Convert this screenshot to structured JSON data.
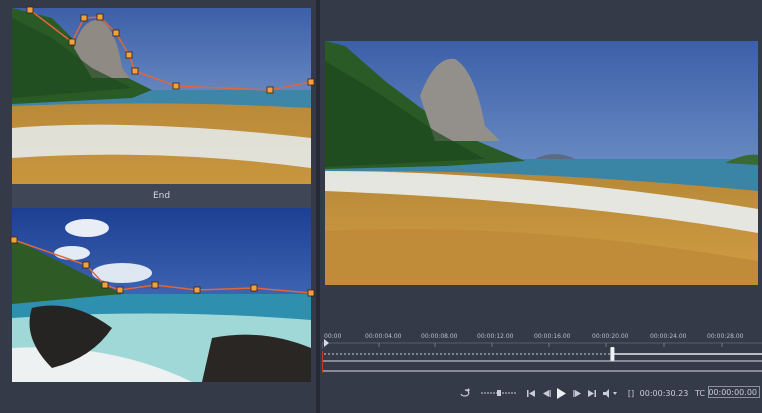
{
  "left_panel": {
    "start_thumbnail": {
      "image": "beach-with-rock-peak"
    },
    "end_label": "End",
    "end_thumbnail": {
      "image": "tropical-beach-with-rocks"
    }
  },
  "preview": {
    "image": "beach-with-rock-peak"
  },
  "timeline": {
    "ticks": [
      "00:00",
      "00:00:04.00",
      "00:00:08.00",
      "00:00:12.00",
      "00:00:16.00",
      "00:00:20.00",
      "00:00:24.00",
      "00:00:28.00"
    ],
    "playhead_fraction": 0.66
  },
  "transport": {
    "loop_icon": "loop-icon",
    "shuttle_icon": "shuttle-slider-icon",
    "duration": "00:00:30.23",
    "bracket_icon": "[]",
    "tc_label": "TC",
    "timecode": "00:00:00.00"
  },
  "colors": {
    "path_line": "#e0673b",
    "keyframe": "#f2a23a",
    "bg": "#2e3340"
  }
}
